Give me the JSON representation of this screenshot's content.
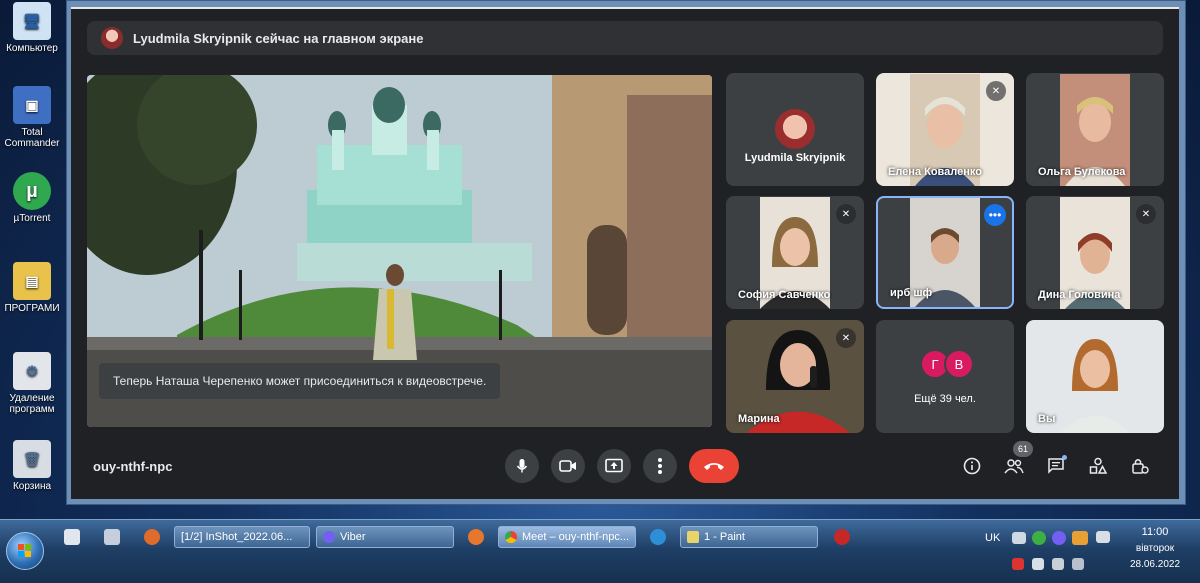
{
  "desktop": {
    "icons": [
      {
        "label": "Компьютер",
        "icon": "computer-icon"
      },
      {
        "label": "Total Commander",
        "icon": "floppy-disk-icon"
      },
      {
        "label": "µTorrent",
        "icon": "utorrent-icon"
      },
      {
        "label": "ПРОГРАМИ",
        "icon": "folder-icon"
      },
      {
        "label": "Удаление программ",
        "icon": "uninstall-icon"
      },
      {
        "label": "Корзина",
        "icon": "recycle-bin-icon"
      }
    ]
  },
  "meet": {
    "banner": "Lyudmila Skryipnik сейчас на главном экране",
    "toast": "Теперь Наташа Черепенко может присоединиться к видеовстрече.",
    "meeting_code": "ouy-nthf-npc",
    "people_count": "61",
    "participants": [
      {
        "name": "Lyudmila Skryipnik",
        "type": "avatar"
      },
      {
        "name": "Елена Коваленко",
        "muted": true
      },
      {
        "name": "Ольга Булекова"
      },
      {
        "name": "София Савченко",
        "muted": true
      },
      {
        "name": "ирб шф",
        "more": true
      },
      {
        "name": "Дина Головина",
        "muted": true
      },
      {
        "name": "Марина",
        "muted": true
      },
      {
        "name": "Ещё 39 чел.",
        "initials": [
          "Г",
          "В"
        ]
      },
      {
        "name": "Вы"
      }
    ],
    "controls": [
      "microphone-icon",
      "camera-icon",
      "present-screen-icon",
      "more-options-icon",
      "end-call-icon"
    ],
    "right_controls": [
      "info-icon",
      "people-icon",
      "chat-icon",
      "activities-icon",
      "host-controls-icon"
    ],
    "colors": {
      "end_call": "#ea4335",
      "avatar_initial": "#d81b60",
      "speaking_border": "#8ab4f8",
      "more_button": "#1a73e8"
    }
  },
  "taskbar": {
    "tasks": [
      "[1/2] InShot_2022.06...",
      "Viber",
      "Meet – ouy-nthf-npc...",
      "1 - Paint"
    ],
    "language": "UK",
    "time": "11:00",
    "weekday": "вівторок",
    "date": "28.06.2022"
  }
}
